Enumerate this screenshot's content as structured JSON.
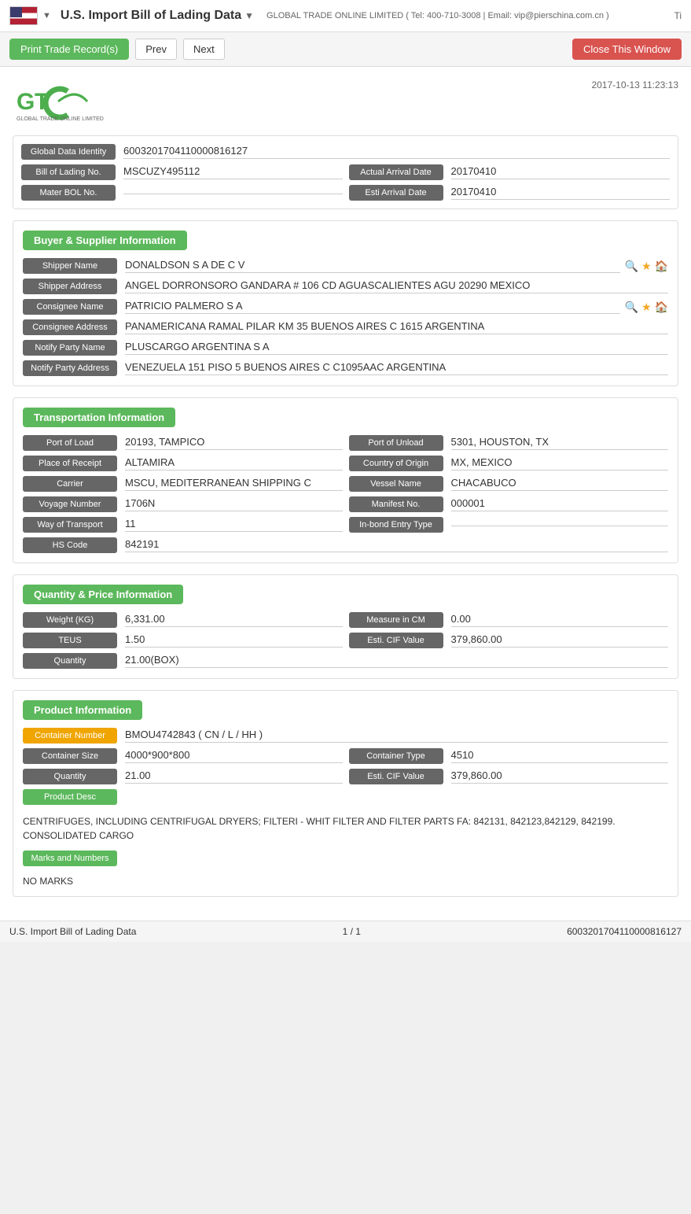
{
  "topbar": {
    "title": "U.S. Import Bill of Lading Data",
    "arrow": "▼",
    "subtitle": "GLOBAL TRADE ONLINE LIMITED ( Tel: 400-710-3008 | Email: vip@pierschina.com.cn )",
    "right_label": "Ti"
  },
  "toolbar": {
    "print_label": "Print Trade Record(s)",
    "prev_label": "Prev",
    "next_label": "Next",
    "close_label": "Close This Window"
  },
  "logo": {
    "company": "GLOBAL TRADE ONLINE LIMITED",
    "datetime": "2017-10-13 11:23:13"
  },
  "identifiers": {
    "global_data_identity_label": "Global Data Identity",
    "global_data_identity_value": "6003201704110000816127",
    "bill_of_lading_label": "Bill of Lading No.",
    "bill_of_lading_value": "MSCUZY495112",
    "actual_arrival_date_label": "Actual Arrival Date",
    "actual_arrival_date_value": "20170410",
    "mater_bol_label": "Mater BOL No.",
    "mater_bol_value": "",
    "esti_arrival_date_label": "Esti Arrival Date",
    "esti_arrival_date_value": "20170410"
  },
  "buyer_supplier": {
    "section_title": "Buyer & Supplier Information",
    "shipper_name_label": "Shipper Name",
    "shipper_name_value": "DONALDSON S A DE C V",
    "shipper_address_label": "Shipper Address",
    "shipper_address_value": "ANGEL DORRONSORO GANDARA # 106 CD AGUASCALIENTES AGU 20290 MEXICO",
    "consignee_name_label": "Consignee Name",
    "consignee_name_value": "PATRICIO PALMERO S A",
    "consignee_address_label": "Consignee Address",
    "consignee_address_value": "PANAMERICANA RAMAL PILAR KM 35 BUENOS AIRES C 1615 ARGENTINA",
    "notify_party_name_label": "Notify Party Name",
    "notify_party_name_value": "PLUSCARGO ARGENTINA S A",
    "notify_party_address_label": "Notify Party Address",
    "notify_party_address_value": "VENEZUELA 151 PISO 5 BUENOS AIRES C C1095AAC ARGENTINA"
  },
  "transportation": {
    "section_title": "Transportation Information",
    "port_of_load_label": "Port of Load",
    "port_of_load_value": "20193, TAMPICO",
    "port_of_unload_label": "Port of Unload",
    "port_of_unload_value": "5301, HOUSTON, TX",
    "place_of_receipt_label": "Place of Receipt",
    "place_of_receipt_value": "ALTAMIRA",
    "country_of_origin_label": "Country of Origin",
    "country_of_origin_value": "MX, MEXICO",
    "carrier_label": "Carrier",
    "carrier_value": "MSCU, MEDITERRANEAN SHIPPING C",
    "vessel_name_label": "Vessel Name",
    "vessel_name_value": "CHACABUCO",
    "voyage_number_label": "Voyage Number",
    "voyage_number_value": "1706N",
    "manifest_no_label": "Manifest No.",
    "manifest_no_value": "000001",
    "way_of_transport_label": "Way of Transport",
    "way_of_transport_value": "11",
    "inbond_entry_label": "In-bond Entry Type",
    "inbond_entry_value": "",
    "hs_code_label": "HS Code",
    "hs_code_value": "842191"
  },
  "quantity_price": {
    "section_title": "Quantity & Price Information",
    "weight_label": "Weight (KG)",
    "weight_value": "6,331.00",
    "measure_label": "Measure in CM",
    "measure_value": "0.00",
    "teus_label": "TEUS",
    "teus_value": "1.50",
    "esti_cif_label": "Esti. CIF Value",
    "esti_cif_value": "379,860.00",
    "quantity_label": "Quantity",
    "quantity_value": "21.00(BOX)"
  },
  "product": {
    "section_title": "Product Information",
    "container_number_label": "Container Number",
    "container_number_value": "BMOU4742843 ( CN / L / HH )",
    "container_size_label": "Container Size",
    "container_size_value": "4000*900*800",
    "container_type_label": "Container Type",
    "container_type_value": "4510",
    "quantity_label": "Quantity",
    "quantity_value": "21.00",
    "esti_cif_label": "Esti. CIF Value",
    "esti_cif_value": "379,860.00",
    "product_desc_label": "Product Desc",
    "product_desc_text": "CENTRIFUGES, INCLUDING CENTRIFUGAL DRYERS; FILTERI - WHIT FILTER AND FILTER PARTS FA: 842131, 842123,842129, 842199.\nCONSOLIDATED CARGO",
    "marks_label": "Marks and Numbers",
    "marks_value": "NO MARKS"
  },
  "footer": {
    "left": "U.S. Import Bill of Lading Data",
    "center": "1 / 1",
    "right": "6003201704110000816127"
  }
}
